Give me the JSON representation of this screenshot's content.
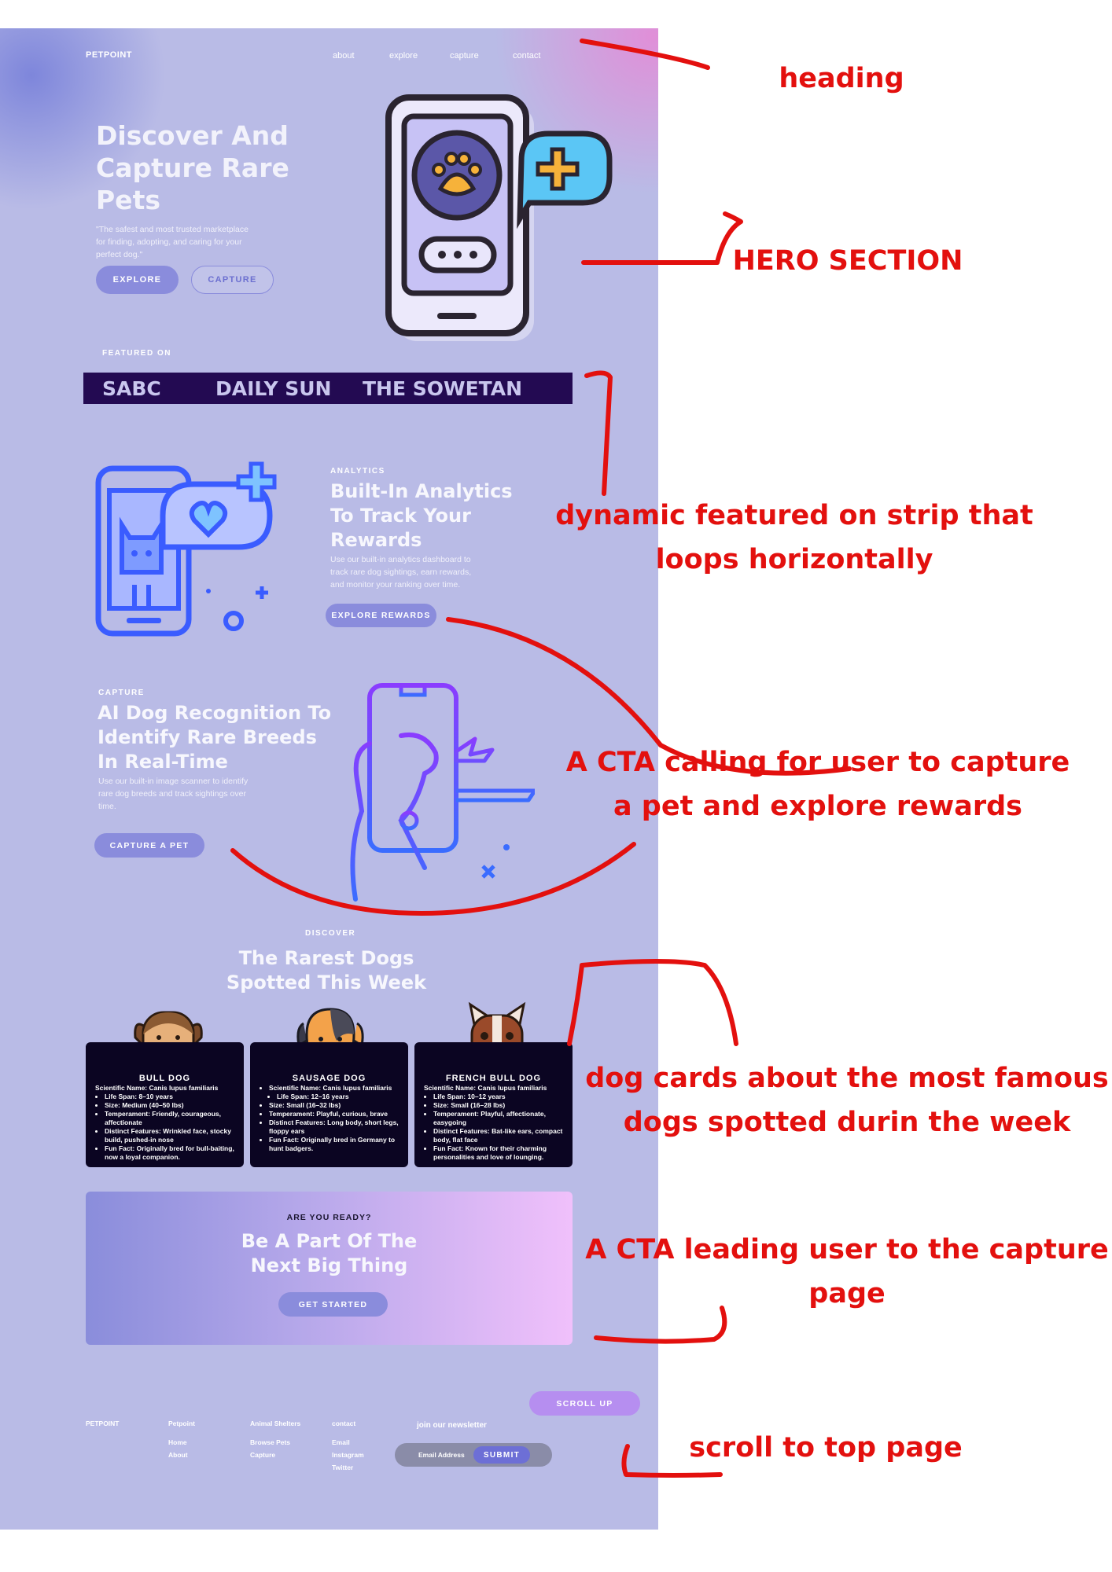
{
  "header": {
    "logo": "PETPOINT",
    "nav": [
      "about",
      "explore",
      "capture",
      "contact"
    ]
  },
  "hero": {
    "title_lines": [
      "Discover And",
      "Capture Rare",
      "Pets"
    ],
    "subtitle_lines": [
      "\"The safest and most trusted marketplace",
      "for finding, adopting, and caring for your",
      "perfect dog.\""
    ],
    "explore_label": "EXPLORE",
    "capture_label": "CAPTURE"
  },
  "featured": {
    "label": "FEATURED ON",
    "outlets": [
      "SABC",
      "DAILY SUN",
      "THE SOWETAN"
    ]
  },
  "analytics": {
    "eyebrow": "ANALYTICS",
    "title_lines": [
      "Built-In Analytics",
      "To Track Your",
      "Rewards"
    ],
    "desc_lines": [
      "Use our built-in analytics dashboard to",
      "track rare dog sightings, earn rewards,",
      "and monitor your ranking over time."
    ],
    "button": "EXPLORE REWARDS"
  },
  "capture": {
    "eyebrow": "CAPTURE",
    "title_lines": [
      "AI Dog Recognition To",
      "Identify  Rare Breeds",
      "In Real-Time"
    ],
    "desc_lines": [
      "Use our built-in image scanner to identify",
      "rare dog breeds and track sightings over",
      "time."
    ],
    "button": "CAPTURE A PET"
  },
  "discover": {
    "eyebrow": "DISCOVER",
    "title_lines": [
      "The Rarest Dogs",
      "Spotted This Week"
    ],
    "cards": [
      {
        "name": "BULL DOG",
        "scientific": "Scientific Name: Canis lupus familiaris",
        "facts": [
          "Life Span: 8–10 years",
          "Size: Medium (40–50 lbs)",
          "Temperament: Friendly, courageous, affectionate",
          "Distinct Features: Wrinkled face, stocky build, pushed-in nose",
          "Fun Fact: Originally bred for bull-baiting, now a loyal companion."
        ]
      },
      {
        "name": "SAUSAGE DOG",
        "scientific": "Scientific Name: Canis lupus familiaris",
        "facts": [
          "Life Span: 12–16 years",
          "Size: Small (16–32 lbs)",
          "Temperament: Playful, curious, brave",
          "Distinct Features: Long body, short legs, floppy ears",
          "Fun Fact: Originally bred in Germany to hunt badgers."
        ]
      },
      {
        "name": "FRENCH BULL DOG",
        "scientific": "Scientific Name: Canis lupus familiaris",
        "facts": [
          "Life Span: 10–12 years",
          "Size: Small (16–28 lbs)",
          "Temperament: Playful, affectionate, easygoing",
          "Distinct Features: Bat-like ears, compact body, flat face",
          "Fun Fact: Known for their charming personalities and love of lounging."
        ]
      }
    ]
  },
  "cta": {
    "eyebrow": "ARE YOU READY?",
    "title_lines": [
      "Be A Part Of The",
      "Next Big Thing"
    ],
    "button": "GET STARTED"
  },
  "footer": {
    "scroll_up": "SCROLL UP",
    "logo": "PETPOINT",
    "col1": {
      "title": "Petpoint",
      "links": [
        "Home",
        "About"
      ]
    },
    "col2": {
      "title": "Animal Shelters",
      "links": [
        "Browse Pets",
        "Capture"
      ]
    },
    "col3": {
      "title": "contact",
      "links": [
        "Email",
        "Instagram",
        "Twitter"
      ]
    },
    "newsletter": {
      "title": "join our newsletter",
      "placeholder": "Email Address",
      "submit": "SUBMIT"
    }
  },
  "annotations": {
    "heading": "heading",
    "hero": "HERO SECTION",
    "strip": [
      "dynamic featured on strip that",
      "loops horizontally"
    ],
    "cta1": [
      "A CTA calling for user to capture",
      "a pet and explore rewards"
    ],
    "cards": [
      "dog cards about the most famous",
      "dogs spotted durin the week"
    ],
    "cta2": [
      "A CTA leading user to the capture",
      "page"
    ],
    "scroll": "scroll to top page"
  },
  "colors": {
    "accent": "#8a8cdc",
    "strip": "#230a52",
    "card": "#0b0522",
    "annotation": "#e3100e"
  }
}
